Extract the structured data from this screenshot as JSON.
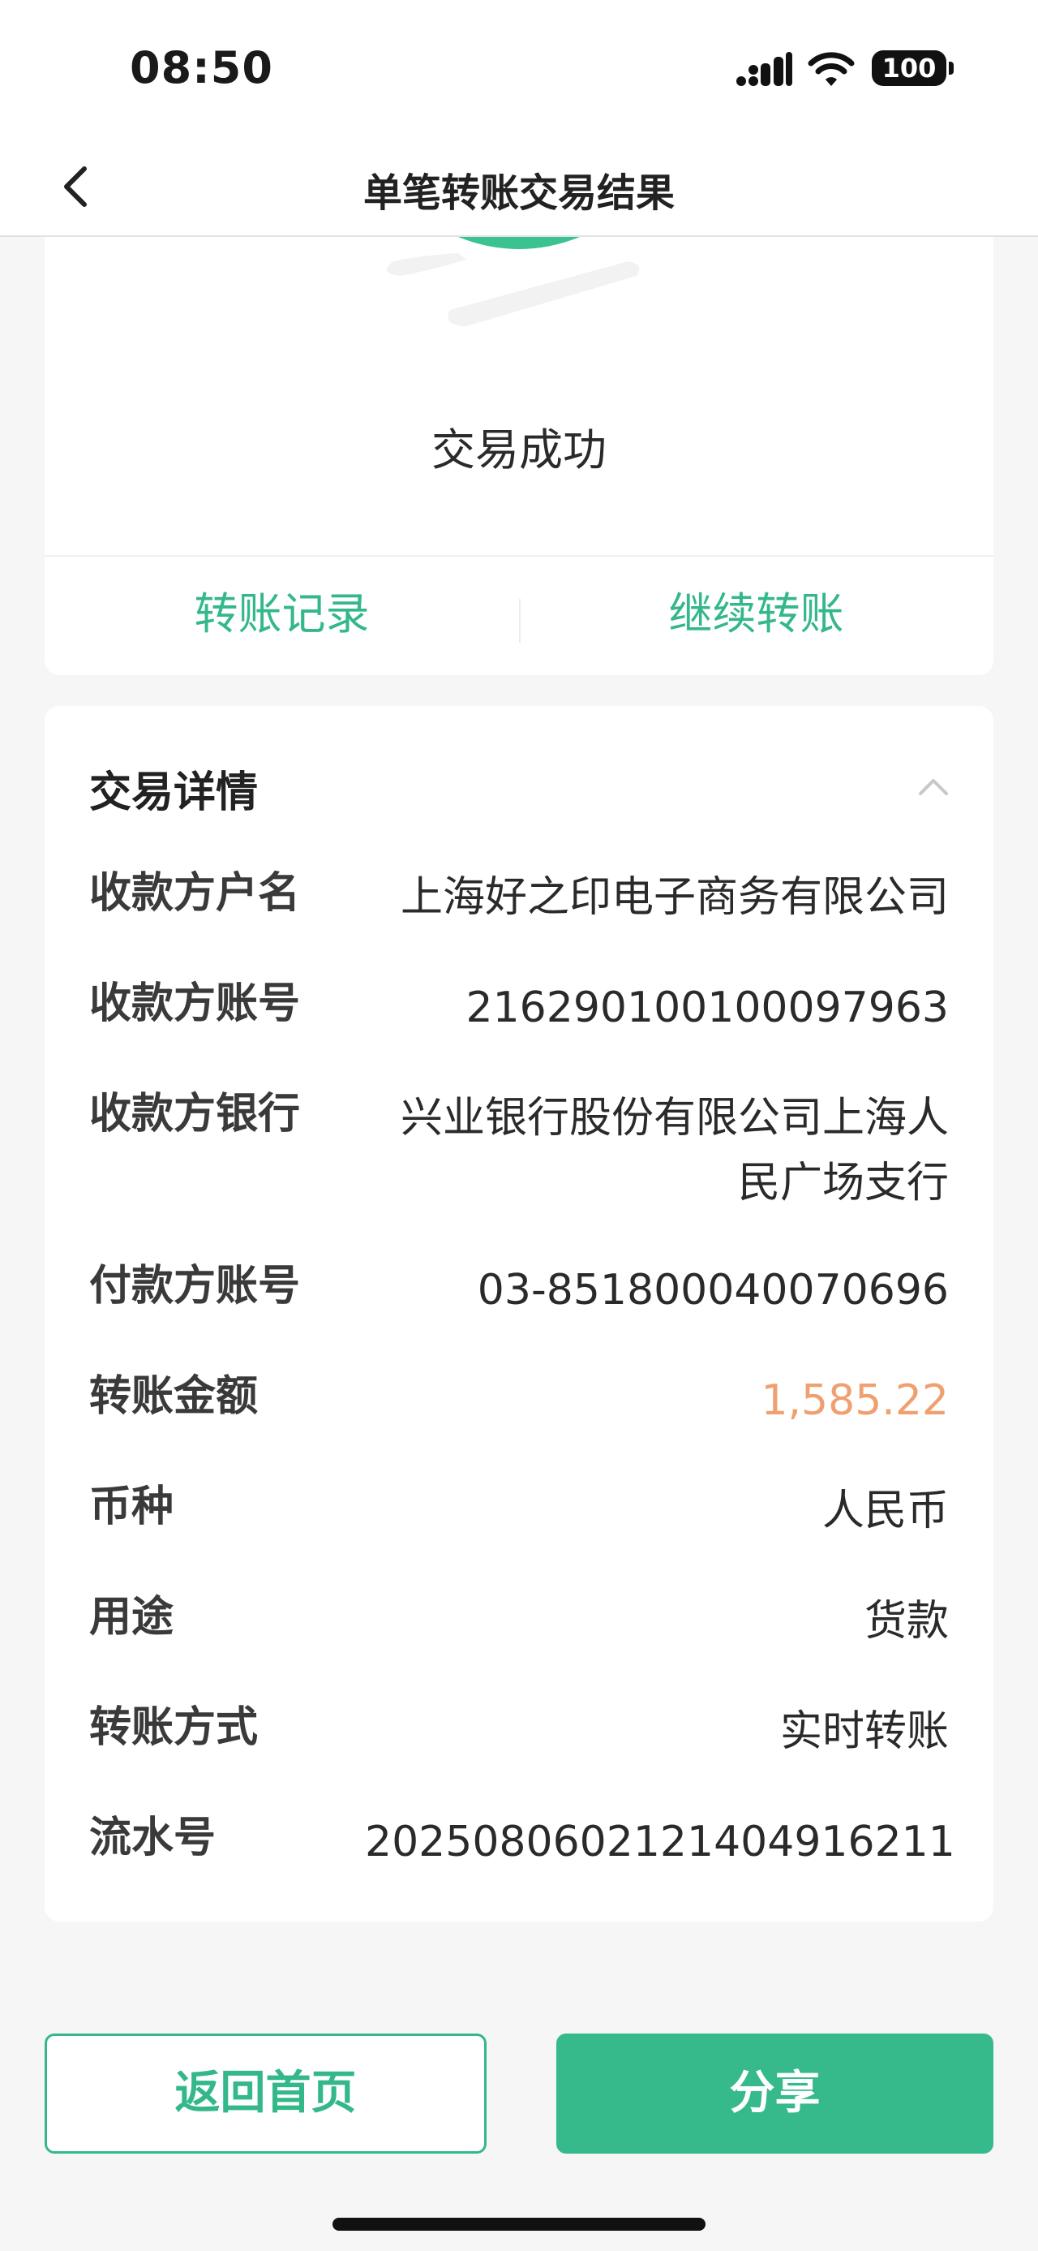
{
  "status_bar": {
    "time": "08:50",
    "battery": "100",
    "icons": [
      "cellular-signal-icon",
      "wifi-icon",
      "battery-icon"
    ]
  },
  "nav": {
    "title": "单笔转账交易结果",
    "back_icon": "chevron-left-icon"
  },
  "result": {
    "status_text": "交易成功",
    "actions": {
      "records": "转账记录",
      "continue": "继续转账"
    },
    "accent_color": "#34b88a"
  },
  "details": {
    "header": "交易详情",
    "collapse_icon": "chevron-up-icon",
    "rows": [
      {
        "label": "收款方户名",
        "value": "上海好之印电子商务有限公司"
      },
      {
        "label": "收款方账号",
        "value": "216290100100097963"
      },
      {
        "label": "收款方银行",
        "value": "兴业银行股份有限公司上海人民广场支行",
        "value_line1": "兴业银行股份有限公司上海人",
        "value_line2": "民广场支行"
      },
      {
        "label": "付款方账号",
        "value": "03-851800040070696"
      },
      {
        "label": "转账金额",
        "value": "1,585.22"
      },
      {
        "label": "币种",
        "value": "人民币"
      },
      {
        "label": "用途",
        "value": "货款"
      },
      {
        "label": "转账方式",
        "value": "实时转账"
      },
      {
        "label": "流水号",
        "value": "2025080602121404916211"
      }
    ],
    "amount_color": "#f0a070"
  },
  "buttons": {
    "home": "返回首页",
    "share": "分享"
  }
}
